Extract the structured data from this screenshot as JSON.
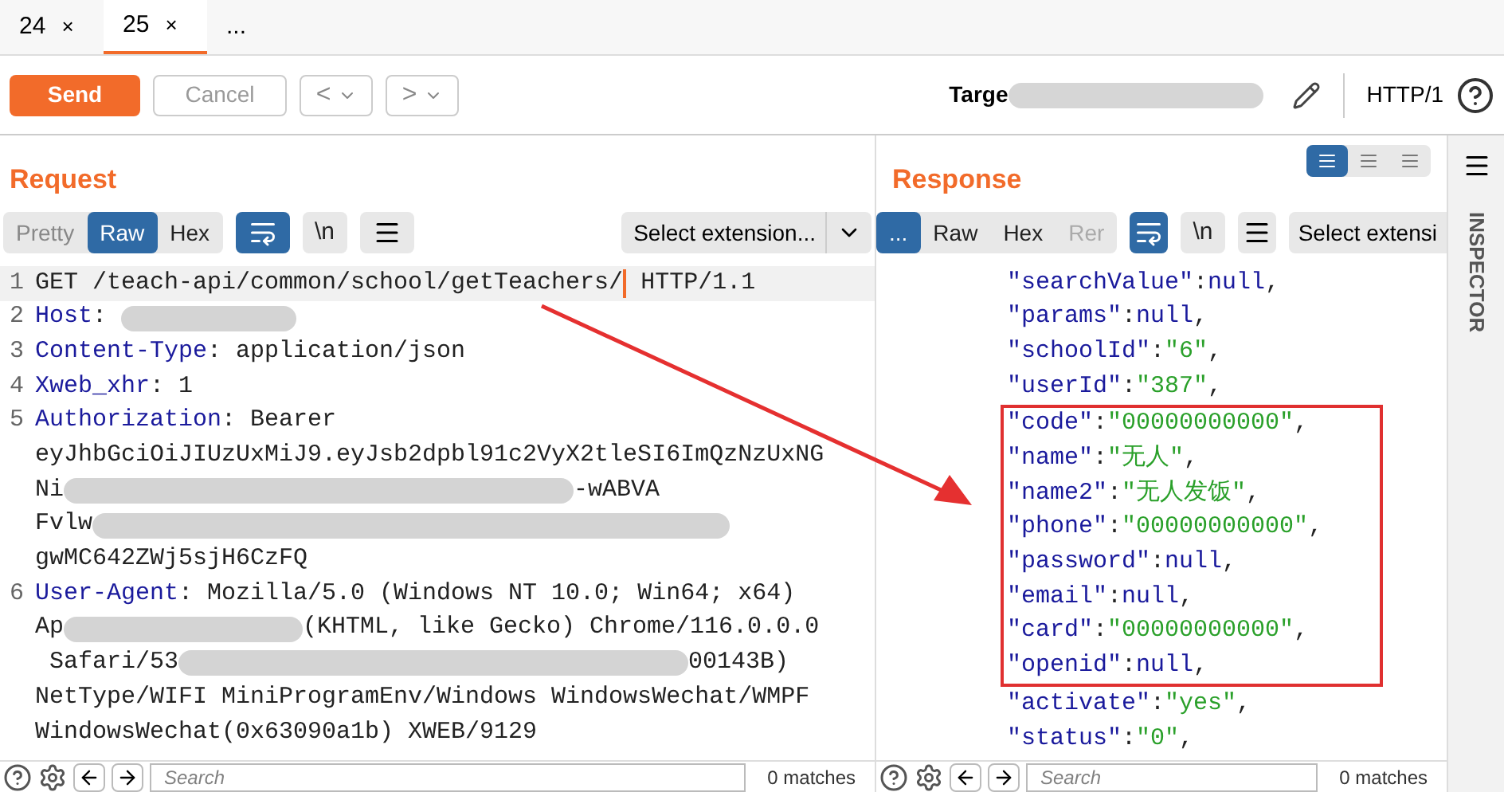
{
  "tabs": [
    {
      "label": "24",
      "close": "×",
      "selected": false
    },
    {
      "label": "25",
      "close": "×",
      "selected": true
    },
    {
      "label": "...",
      "selected": false
    }
  ],
  "toolbar": {
    "send": "Send",
    "cancel": "Cancel",
    "back": "<",
    "forward": ">",
    "target_label": "Targe",
    "protocol": "HTTP/1"
  },
  "request": {
    "title": "Request",
    "view_tabs": [
      {
        "label": "Pretty",
        "selected": false
      },
      {
        "label": "Raw",
        "selected": true
      },
      {
        "label": "Hex",
        "selected": false
      }
    ],
    "wrap_on": true,
    "newline": "\\n",
    "extension": "Select extension...",
    "lines": [
      {
        "number": "1",
        "parts": [
          {
            "kind": "text",
            "text": "GET /teach-api/common/school/getTeachers/"
          },
          {
            "kind": "cursor"
          },
          {
            "kind": "text",
            "text": " HTTP/1.1"
          }
        ]
      },
      {
        "number": "2",
        "parts": [
          {
            "kind": "key",
            "text": "Host"
          },
          {
            "kind": "text",
            "text": ": "
          },
          {
            "kind": "blur_s"
          }
        ]
      },
      {
        "number": "3",
        "parts": [
          {
            "kind": "key",
            "text": "Content-Type"
          },
          {
            "kind": "text",
            "text": ": application/json"
          }
        ]
      },
      {
        "number": "4",
        "parts": [
          {
            "kind": "key",
            "text": "Xweb_xhr"
          },
          {
            "kind": "text",
            "text": ": 1"
          }
        ]
      },
      {
        "number": "5",
        "parts": [
          {
            "kind": "key",
            "text": "Authorization"
          },
          {
            "kind": "text",
            "text": ": Bearer"
          }
        ]
      },
      {
        "parts": [
          {
            "kind": "text",
            "text": "eyJhbGciOiJIUzUxMiJ9.eyJsb2dpbl91c2VyX2tleSI6ImQzNzUxNG"
          }
        ]
      },
      {
        "parts": [
          {
            "kind": "text",
            "text": "Ni"
          },
          {
            "kind": "blur_l"
          },
          {
            "kind": "text",
            "text": "-wABVA"
          }
        ]
      },
      {
        "parts": [
          {
            "kind": "text",
            "text": "Fvlw"
          },
          {
            "kind": "blur_xl"
          }
        ]
      },
      {
        "parts": [
          {
            "kind": "text",
            "text": "gwMC642ZWj5sjH6CzFQ"
          }
        ]
      },
      {
        "number": "6",
        "parts": [
          {
            "kind": "key",
            "text": "User-Agent"
          },
          {
            "kind": "text",
            "text": ": Mozilla/5.0 (Windows NT 10.0; Win64; x64)"
          }
        ]
      },
      {
        "parts": [
          {
            "kind": "text",
            "text": "Ap"
          },
          {
            "kind": "blur_m"
          },
          {
            "kind": "text",
            "text": "(KHTML, like Gecko) Chrome/116.0.0.0"
          }
        ]
      },
      {
        "parts": [
          {
            "kind": "text",
            "text": " Safari/53"
          },
          {
            "kind": "blur_l"
          },
          {
            "kind": "text",
            "text": "00143B)"
          }
        ]
      },
      {
        "parts": [
          {
            "kind": "text",
            "text": "NetType/WIFI MiniProgramEnv/Windows WindowsWechat/WMPF"
          }
        ]
      },
      {
        "parts": [
          {
            "kind": "text",
            "text": "WindowsWechat(0x63090a1b) XWEB/9129"
          }
        ]
      }
    ],
    "search": {
      "placeholder": "Search",
      "matches": "0 matches"
    }
  },
  "response": {
    "title": "Response",
    "layouts": [
      {
        "selected": true
      },
      {
        "selected": false
      },
      {
        "selected": false
      }
    ],
    "view_tabs": [
      {
        "label": "...",
        "selected": true
      },
      {
        "label": "Raw",
        "selected": false
      },
      {
        "label": "Hex",
        "selected": false
      },
      {
        "label": "Rer",
        "selected": false
      }
    ],
    "wrap_on": true,
    "newline": "\\n",
    "extension": "Select extensi",
    "blocks": [
      {
        "boxed": false,
        "lines": [
          {
            "key": "\"searchValue\"",
            "sep": ":",
            "value": "null",
            "end": ",",
            "kind": "literal"
          },
          {
            "key": "\"params\"",
            "sep": ":",
            "value": "null",
            "end": ",",
            "kind": "literal"
          },
          {
            "key": "\"schoolId\"",
            "sep": ":",
            "value": "\"6\"",
            "end": ",",
            "kind": "string"
          },
          {
            "key": "\"userId\"",
            "sep": ":",
            "value": "\"387\"",
            "end": ",",
            "kind": "string"
          }
        ]
      },
      {
        "boxed": true,
        "lines": [
          {
            "key": "\"code\"",
            "sep": ":",
            "value": "\"00000000000\"",
            "end": ",",
            "kind": "string"
          },
          {
            "key": "\"name\"",
            "sep": ":",
            "value": "\"无人\"",
            "end": ",",
            "kind": "string"
          },
          {
            "key": "\"name2\"",
            "sep": ":",
            "value": "\"无人发饭\"",
            "end": ",",
            "kind": "string"
          },
          {
            "key": "\"phone\"",
            "sep": ":",
            "value": "\"00000000000\"",
            "end": ",",
            "kind": "string"
          },
          {
            "key": "\"password\"",
            "sep": ":",
            "value": "null",
            "end": ",",
            "kind": "literal"
          },
          {
            "key": "\"email\"",
            "sep": ":",
            "value": "null",
            "end": ",",
            "kind": "literal"
          },
          {
            "key": "\"card\"",
            "sep": ":",
            "value": "\"00000000000\"",
            "end": ",",
            "kind": "string"
          },
          {
            "key": "\"openid\"",
            "sep": ":",
            "value": "null",
            "end": ",",
            "kind": "literal"
          }
        ]
      },
      {
        "boxed": false,
        "lines": [
          {
            "key": "\"activate\"",
            "sep": ":",
            "value": "\"yes\"",
            "end": ",",
            "kind": "string"
          },
          {
            "key": "\"status\"",
            "sep": ":",
            "value": "\"0\"",
            "end": ",",
            "kind": "string"
          }
        ]
      }
    ],
    "search": {
      "placeholder": "Search",
      "matches": "0 matches"
    }
  },
  "inspector": {
    "label": "INSPECTOR"
  }
}
